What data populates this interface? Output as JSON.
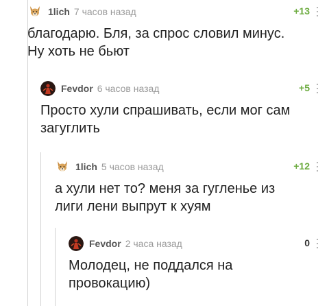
{
  "comments": [
    {
      "author": "1lich",
      "time": "7 часов назад",
      "rating": "+13",
      "text_lines": [
        "благодарю. Бля, за спрос словил минус.",
        "Ну хоть не бьют"
      ],
      "avatar_icon": "corgi-avatar-icon"
    },
    {
      "author": "Fevdor",
      "time": "6 часов назад",
      "rating": "+5",
      "text_lines": [
        "Просто хули спрашивать, если мог сам",
        "загуглить"
      ],
      "avatar_icon": "red-figure-avatar-icon"
    },
    {
      "author": "1lich",
      "time": "5 часов назад",
      "rating": "+12",
      "text_lines": [
        "а хули нет то? меня за гугленье из",
        "лиги лени выпрут к хуям"
      ],
      "avatar_icon": "corgi-avatar-icon"
    },
    {
      "author": "Fevdor",
      "time": "2 часа назад",
      "rating": "0",
      "text_lines": [
        "Молодец, не поддался на",
        "провокацию)"
      ],
      "avatar_icon": "red-figure-avatar-icon"
    }
  ],
  "colors": {
    "positive_rating": "#6cab3f",
    "zero_rating": "#333333",
    "thread_line": "#d2d2d2",
    "meta_text": "#9a9a9a"
  }
}
